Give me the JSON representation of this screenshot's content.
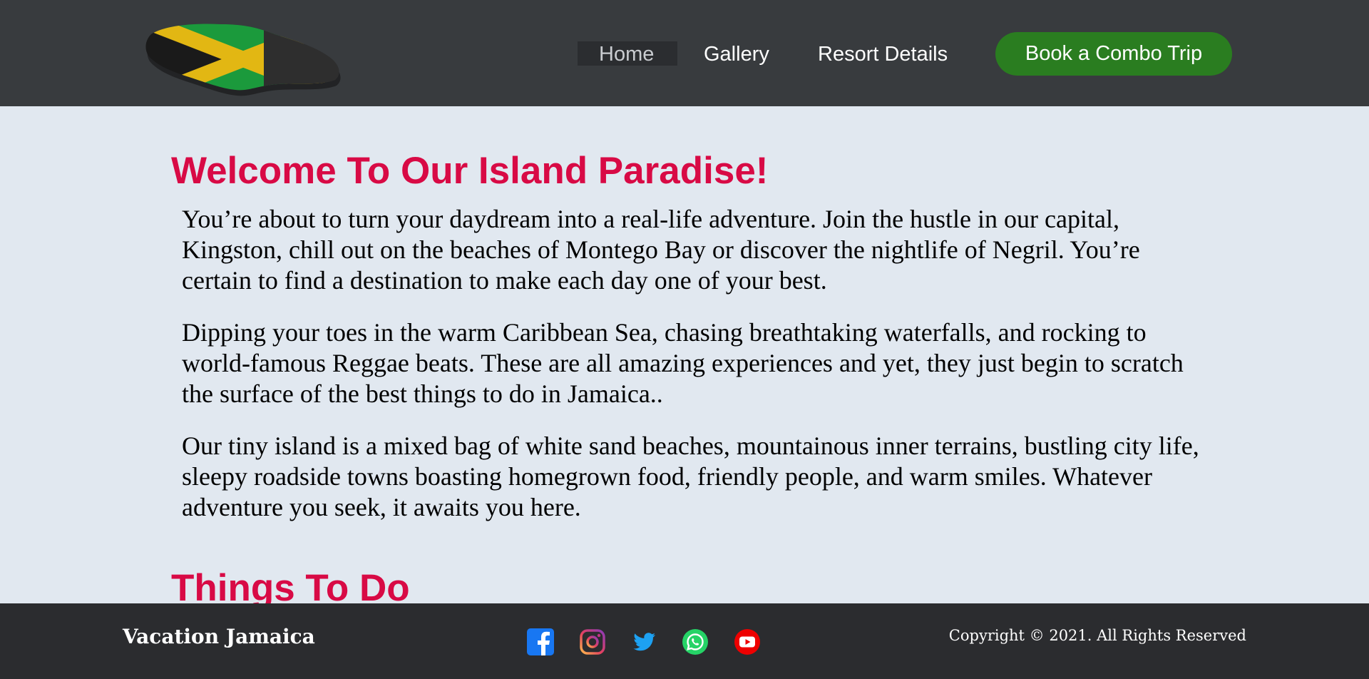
{
  "header": {
    "logo_icon": "jamaica-map-flag-icon",
    "nav": [
      {
        "label": "Home",
        "active": true
      },
      {
        "label": "Gallery",
        "active": false
      },
      {
        "label": "Resort Details",
        "active": false
      }
    ],
    "cta_label": "Book a Combo Trip"
  },
  "main": {
    "welcome_title": "Welcome To Our Island Paradise!",
    "paragraphs": [
      "You’re about to turn your daydream into a real-life adventure. Join the hustle in our capital, Kingston, chill out on the beaches of Montego Bay or discover the nightlife of Negril. You’re certain to find a destination to make each day one of your best.",
      "Dipping your toes in the warm Caribbean Sea, chasing breathtaking waterfalls, and rocking to world-famous Reggae beats. These are all amazing experiences and yet, they just begin to scratch the surface of the best things to do in Jamaica..",
      "Our tiny island is a mixed bag of white sand beaches, mountainous inner terrains, bustling city life, sleepy roadside towns boasting homegrown food, friendly people, and warm smiles. Whatever adventure you seek, it awaits you here."
    ],
    "things_title": "Things To Do"
  },
  "footer": {
    "brand": "Vacation Jamaica",
    "social_icons": [
      "facebook-icon",
      "instagram-icon",
      "twitter-icon",
      "whatsapp-icon",
      "youtube-icon"
    ],
    "copyright": "Copyright © 2021. All Rights Reserved"
  },
  "colors": {
    "header_bg": "#383b3e",
    "page_bg": "#e1e8f0",
    "heading": "#d80a45",
    "cta": "#2a7d20",
    "footer_bg": "#2b2c2f"
  }
}
